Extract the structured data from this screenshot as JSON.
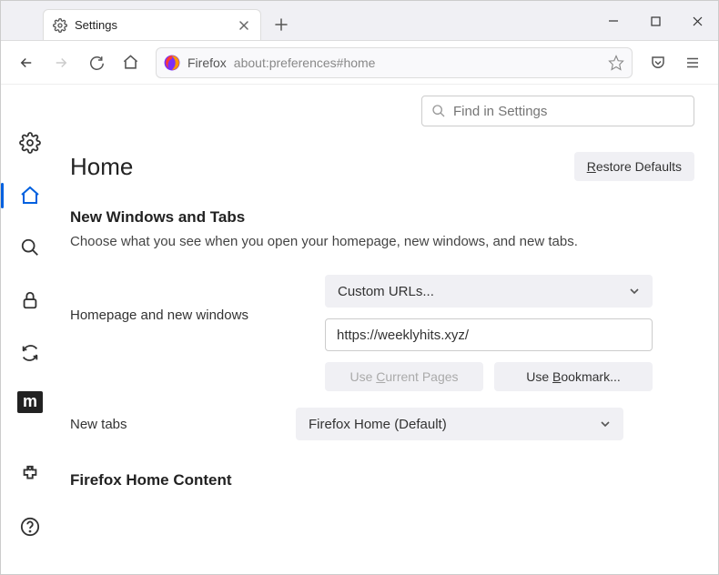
{
  "tab": {
    "title": "Settings"
  },
  "toolbar": {
    "identity": "Firefox",
    "url": "about:preferences#home"
  },
  "search": {
    "placeholder": "Find in Settings"
  },
  "page": {
    "title": "Home",
    "restore_defaults": "Restore Defaults"
  },
  "section": {
    "heading": "New Windows and Tabs",
    "description": "Choose what you see when you open your homepage, new windows, and new tabs."
  },
  "homepage": {
    "label": "Homepage and new windows",
    "select_value": "Custom URLs...",
    "url_value": "https://weeklyhits.xyz/",
    "use_current_prefix": "Use ",
    "use_current_u": "C",
    "use_current_suffix": "urrent Pages",
    "use_bookmark_prefix": "Use ",
    "use_bookmark_u": "B",
    "use_bookmark_suffix": "ookmark..."
  },
  "newtabs": {
    "label": "New tabs",
    "select_value": "Firefox Home (Default)"
  },
  "section2": {
    "heading": "Firefox Home Content"
  },
  "restore": {
    "prefix": "",
    "u": "R",
    "suffix": "estore Defaults"
  }
}
